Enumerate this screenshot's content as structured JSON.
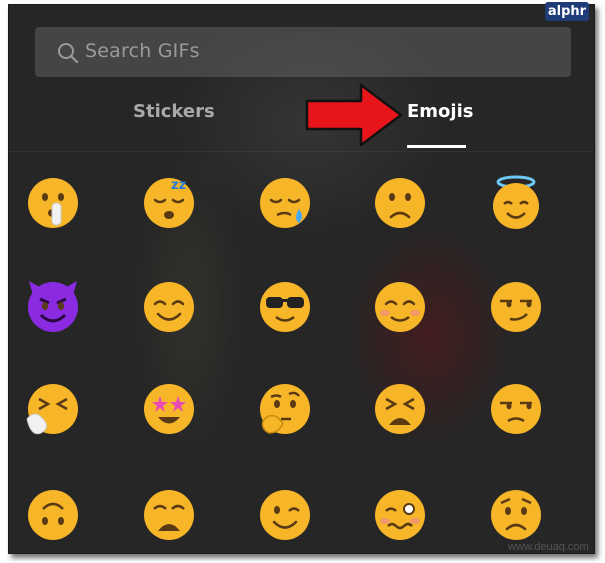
{
  "brand": {
    "badge": "alphr"
  },
  "search": {
    "placeholder": "Search GIFs"
  },
  "tabs": [
    {
      "label": "Stickers",
      "active": false
    },
    {
      "label": "Emojis",
      "active": true
    }
  ],
  "annotation": {
    "type": "red-arrow",
    "points_to": "Emojis tab",
    "color": "#e8141b"
  },
  "colors": {
    "background": "#262626",
    "search_bg": "#5c5c5c",
    "active_tab": "#ffffff",
    "inactive_tab": "#a9a9a9",
    "emoji_yellow": "#f7b628",
    "devil_purple": "#8a2be2"
  },
  "emoji_grid": [
    [
      "shushing-face",
      "sleeping-face",
      "sleepy-face",
      "slightly-frowning-face",
      "smiling-face-with-halo"
    ],
    [
      "smiling-face-with-horns",
      "smiling-face",
      "smiling-face-with-sunglasses",
      "blushing-face",
      "smirking-face"
    ],
    [
      "sneezing-face",
      "star-struck",
      "thinking-face",
      "tired-face",
      "unamused-face"
    ],
    [
      "upside-down-face",
      "weary-face",
      "winking-face",
      "woozy-face",
      "worried-face"
    ]
  ],
  "footer": {
    "watermark": "www.deuaq.com"
  }
}
